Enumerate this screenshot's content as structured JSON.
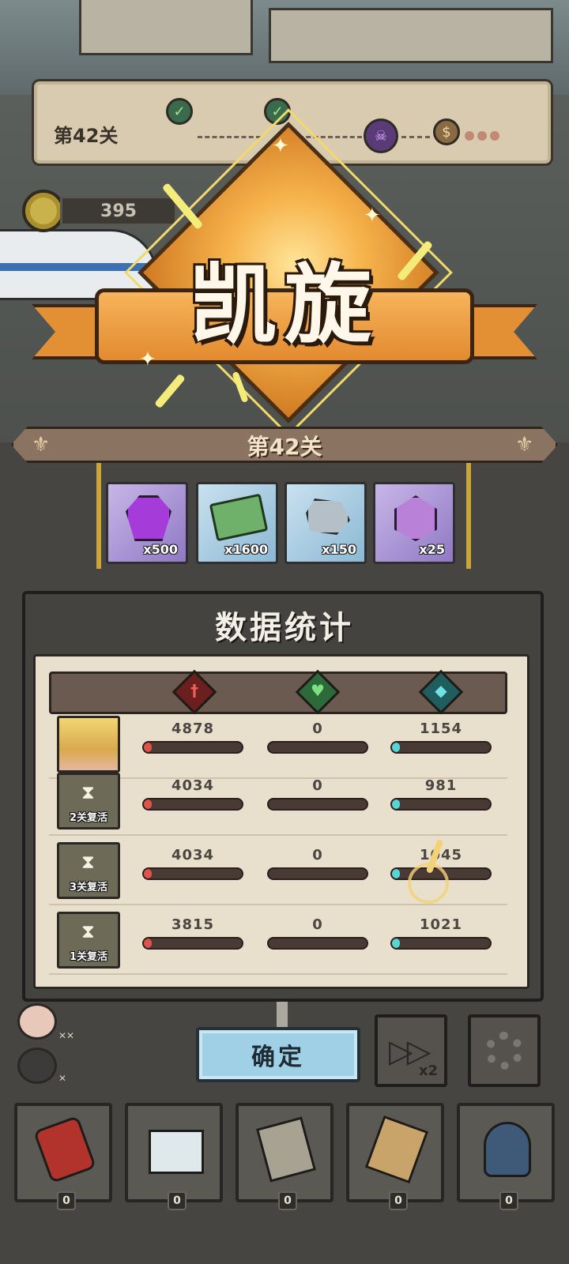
{
  "hud": {
    "level_label": "第42关",
    "coins": "395",
    "nodes": [
      "node-cleared",
      "node-cleared",
      "boss",
      "treasure-bag"
    ]
  },
  "victory": {
    "title": "凯旋",
    "stage_label": "第42关"
  },
  "rewards": [
    {
      "icon": "purple-gem-icon",
      "qty": "x500"
    },
    {
      "icon": "cash-note-icon",
      "qty": "x1600"
    },
    {
      "icon": "ore-icon",
      "qty": "x150"
    },
    {
      "icon": "crystal-icon",
      "qty": "x25"
    }
  ],
  "stats": {
    "title": "数据统计",
    "columns": [
      "attack-icon",
      "heal-icon",
      "shield-icon"
    ],
    "rows": [
      {
        "portrait": "hero-portrait",
        "revive_label": "",
        "damage": "4878",
        "heal": "0",
        "shield": "1154",
        "damage_frac": 0.05,
        "heal_frac": 0,
        "shield_frac": 0.08
      },
      {
        "portrait": "fallen-portrait",
        "revive_label": "2关复活",
        "damage": "4034",
        "heal": "0",
        "shield": "981",
        "damage_frac": 0.04,
        "heal_frac": 0,
        "shield_frac": 0.07
      },
      {
        "portrait": "fallen-portrait",
        "revive_label": "3关复活",
        "damage": "4034",
        "heal": "0",
        "shield": "1045",
        "damage_frac": 0.04,
        "heal_frac": 0,
        "shield_frac": 0.07
      },
      {
        "portrait": "fallen-portrait",
        "revive_label": "1关复活",
        "damage": "3815",
        "heal": "0",
        "shield": "1021",
        "damage_frac": 0.04,
        "heal_frac": 0,
        "shield_frac": 0.07
      }
    ]
  },
  "controls": {
    "confirm": "确定",
    "speed_label": "x2",
    "settings_icon": "gear-icon"
  },
  "items": [
    {
      "icon": "cola-can-icon",
      "count": "0"
    },
    {
      "icon": "first-aid-kit-icon",
      "count": "0"
    },
    {
      "icon": "scroll-map-icon",
      "count": "0"
    },
    {
      "icon": "lightning-paper-icon",
      "count": "0"
    },
    {
      "icon": "nuke-bomb-icon",
      "count": "0"
    }
  ],
  "colors": {
    "victory_orange": "#e38a30",
    "damage_bar": "#e0534b",
    "shield_bar": "#57d6d6",
    "confirm_button": "#9fd0e6"
  }
}
